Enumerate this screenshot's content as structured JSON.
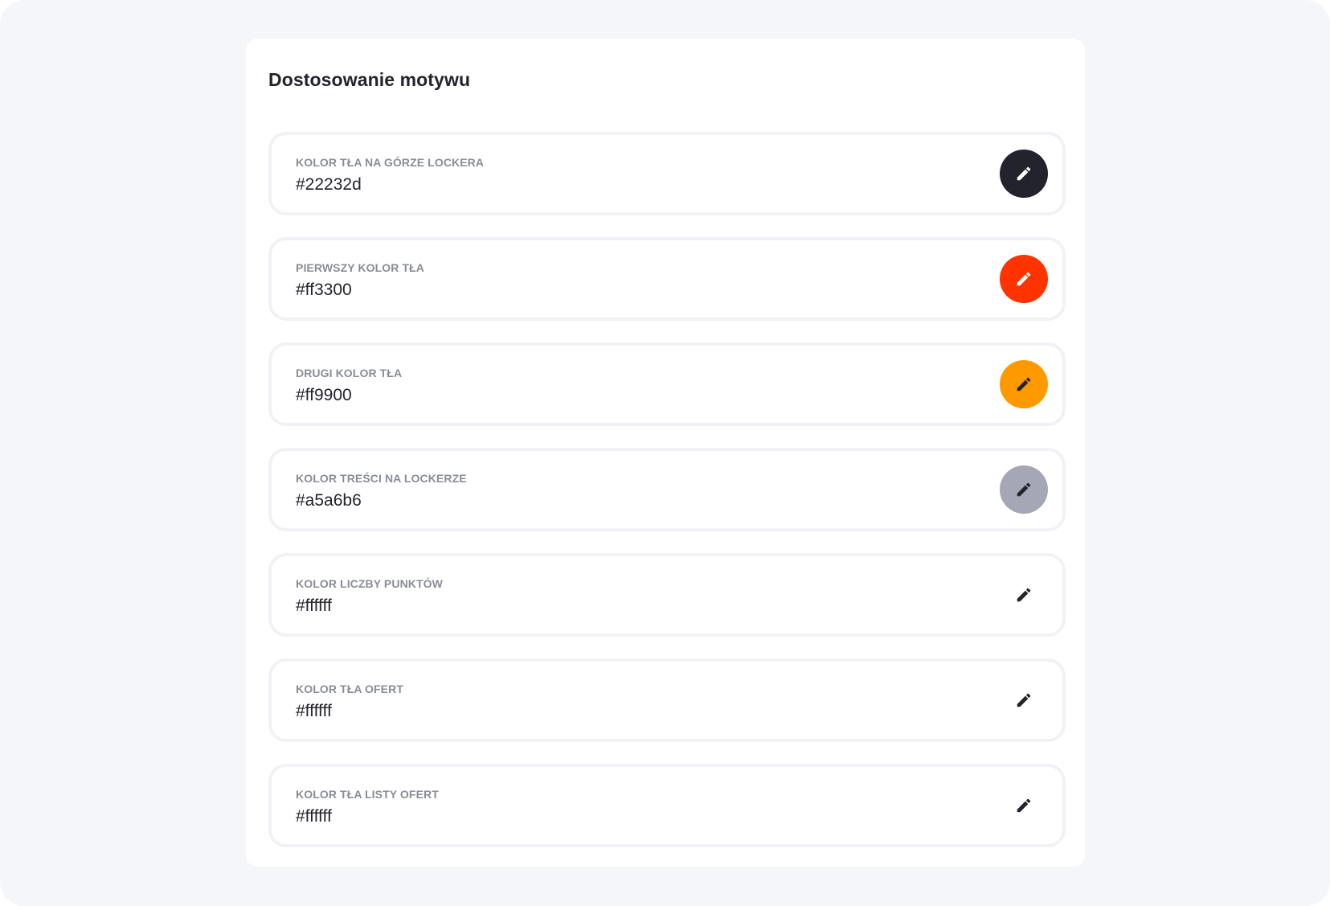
{
  "panel": {
    "title": "Dostosowanie motywu"
  },
  "theme_colors": [
    {
      "label": "KOLOR TŁA NA GÓRZE LOCKERA",
      "value": "#22232d",
      "swatch": "#22232d",
      "icon_color": "#ffffff"
    },
    {
      "label": "PIERWSZY KOLOR TŁA",
      "value": "#ff3300",
      "swatch": "#ff3300",
      "icon_color": "#ffffff"
    },
    {
      "label": "DRUGI KOLOR TŁA",
      "value": "#ff9900",
      "swatch": "#ff9900",
      "icon_color": "#22232d"
    },
    {
      "label": "KOLOR TREŚCI NA LOCKERZE",
      "value": "#a5a6b6",
      "swatch": "#a5a6b6",
      "icon_color": "#22232d"
    },
    {
      "label": "KOLOR LICZBY PUNKTÓW",
      "value": "#ffffff",
      "swatch": "#ffffff",
      "icon_color": "#22232d"
    },
    {
      "label": "KOLOR TŁA OFERT",
      "value": "#ffffff",
      "swatch": "#ffffff",
      "icon_color": "#22232d"
    },
    {
      "label": "KOLOR TŁA LISTY OFERT",
      "value": "#ffffff",
      "swatch": "#ffffff",
      "icon_color": "#22232d"
    }
  ],
  "icons": {
    "edit": "pencil-icon"
  }
}
